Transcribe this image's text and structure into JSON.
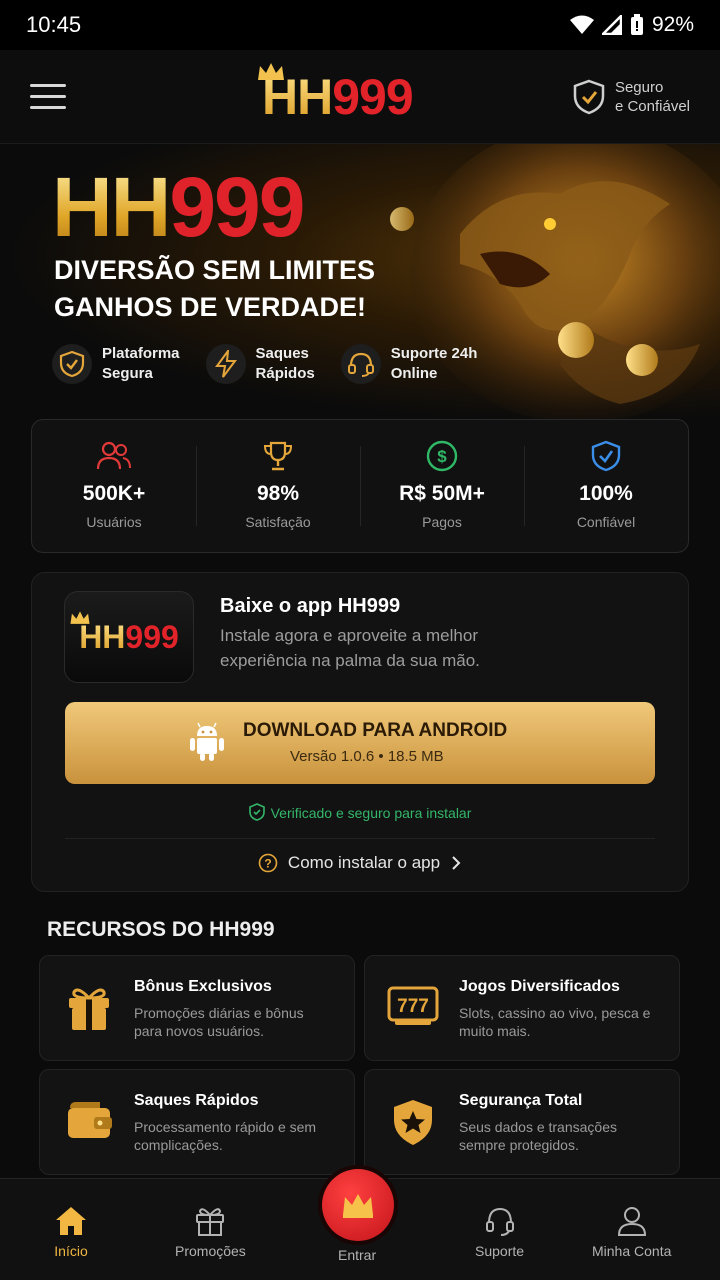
{
  "status_bar": {
    "time": "10:45",
    "battery": "92%"
  },
  "header": {
    "logo_hh": "HH",
    "logo_999": "999",
    "secure_line1": "Seguro",
    "secure_line2": "e Confiável"
  },
  "hero": {
    "title_hh": "HH",
    "title_999": "999",
    "tagline_line1": "DIVERSÃO SEM LIMITES",
    "tagline_line2": "GANHOS DE VERDADE!",
    "features": [
      {
        "line1": "Plataforma",
        "line2": "Segura",
        "icon": "shield-check-icon"
      },
      {
        "line1": "Saques",
        "line2": "Rápidos",
        "icon": "lightning-icon"
      },
      {
        "line1": "Suporte 24h",
        "line2": "Online",
        "icon": "headset-icon"
      }
    ]
  },
  "stats": [
    {
      "value": "500K+",
      "label": "Usuários",
      "icon": "users-icon",
      "color": "#e23a3a"
    },
    {
      "value": "98%",
      "label": "Satisfação",
      "icon": "trophy-icon",
      "color": "#e4a63a"
    },
    {
      "value": "R$ 50M+",
      "label": "Pagos",
      "icon": "dollar-icon",
      "color": "#2fb866"
    },
    {
      "value": "100%",
      "label": "Confiável",
      "icon": "shield-icon",
      "color": "#3b8ee8"
    }
  ],
  "app_card": {
    "icon_hh": "HH",
    "icon_999": "999",
    "title": "Baixe o app HH999",
    "description": "Instale agora e aproveite a melhor experiência na palma da sua mão.",
    "download_label": "DOWNLOAD PARA ANDROID",
    "download_version": "Versão 1.0.6 • 18.5 MB",
    "verified_text": "Verificado e seguro para instalar",
    "howto_text": "Como instalar o app"
  },
  "features_section": {
    "title": "RECURSOS DO HH999",
    "items": [
      {
        "title": "Bônus Exclusivos",
        "desc": "Promoções diárias e bônus para novos usuários.",
        "icon": "gift-icon"
      },
      {
        "title": "Jogos Diversificados",
        "desc": "Slots, cassino ao vivo, pesca e muito mais.",
        "icon": "slot-777-icon"
      },
      {
        "title": "Saques Rápidos",
        "desc": "Processamento rápido e sem complicações.",
        "icon": "wallet-icon"
      },
      {
        "title": "Segurança Total",
        "desc": "Seus dados e transações sempre protegidos.",
        "icon": "shield-star-icon"
      }
    ]
  },
  "bottom_nav": {
    "items": [
      {
        "label": "Início",
        "icon": "home-icon",
        "active": true
      },
      {
        "label": "Promoções",
        "icon": "gift-icon"
      },
      {
        "label": "Entrar",
        "icon": "crown-icon"
      },
      {
        "label": "Suporte",
        "icon": "headset-icon"
      },
      {
        "label": "Minha Conta",
        "icon": "user-icon"
      }
    ]
  },
  "colors": {
    "gold": "#f1b742",
    "red": "#e2232a",
    "green": "#34b66a",
    "background": "#0b0b0b"
  }
}
